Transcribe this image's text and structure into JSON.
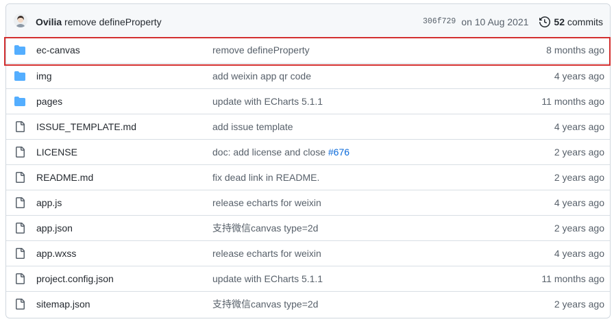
{
  "latest_commit": {
    "author": "Ovilia",
    "message": "remove defineProperty",
    "sha": "306f729",
    "date": "on 10 Aug 2021",
    "commits_count": "52",
    "commits_label": "commits"
  },
  "files": [
    {
      "type": "folder",
      "icon": "folder-icon",
      "name": "ec-canvas",
      "message": "remove defineProperty",
      "issue": "",
      "age": "8 months ago",
      "highlighted": true
    },
    {
      "type": "folder",
      "icon": "folder-icon",
      "name": "img",
      "message": "add weixin app qr code",
      "issue": "",
      "age": "4 years ago"
    },
    {
      "type": "folder",
      "icon": "folder-icon",
      "name": "pages",
      "message": "update with ECharts 5.1.1",
      "issue": "",
      "age": "11 months ago"
    },
    {
      "type": "file",
      "icon": "file-icon",
      "name": "ISSUE_TEMPLATE.md",
      "message": "add issue template",
      "issue": "",
      "age": "4 years ago"
    },
    {
      "type": "file",
      "icon": "file-icon",
      "name": "LICENSE",
      "message": "doc: add license and close ",
      "issue": "#676",
      "age": "2 years ago"
    },
    {
      "type": "file",
      "icon": "file-icon",
      "name": "README.md",
      "message": "fix dead link in README.",
      "issue": "",
      "age": "2 years ago"
    },
    {
      "type": "file",
      "icon": "file-icon",
      "name": "app.js",
      "message": "release echarts for weixin",
      "issue": "",
      "age": "4 years ago"
    },
    {
      "type": "file",
      "icon": "file-icon",
      "name": "app.json",
      "message": "支持微信canvas type=2d",
      "issue": "",
      "age": "2 years ago"
    },
    {
      "type": "file",
      "icon": "file-icon",
      "name": "app.wxss",
      "message": "release echarts for weixin",
      "issue": "",
      "age": "4 years ago"
    },
    {
      "type": "file",
      "icon": "file-icon",
      "name": "project.config.json",
      "message": "update with ECharts 5.1.1",
      "issue": "",
      "age": "11 months ago"
    },
    {
      "type": "file",
      "icon": "file-icon",
      "name": "sitemap.json",
      "message": "支持微信canvas type=2d",
      "issue": "",
      "age": "2 years ago"
    }
  ],
  "colors": {
    "folder": "#54aeff",
    "file": "#57606a",
    "link": "#0969da",
    "highlight": "#d32f2f"
  }
}
